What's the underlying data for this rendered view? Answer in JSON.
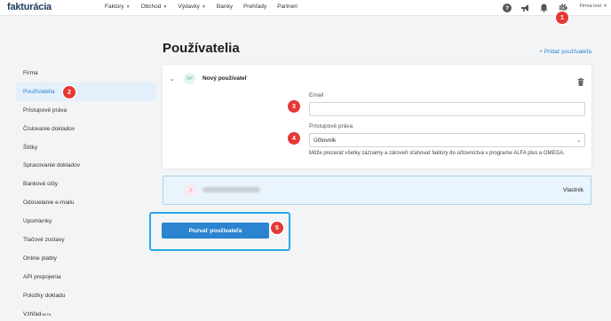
{
  "app": {
    "logo": "fakturácia"
  },
  "nav": {
    "items": [
      {
        "label": "Faktúry",
        "has_dropdown": true
      },
      {
        "label": "Obchod",
        "has_dropdown": true
      },
      {
        "label": "Výdavky",
        "has_dropdown": true
      },
      {
        "label": "Banky",
        "has_dropdown": false
      },
      {
        "label": "Prehľady",
        "has_dropdown": false
      },
      {
        "label": "Partneri",
        "has_dropdown": false
      }
    ],
    "icons": [
      "help-icon",
      "megaphone-icon",
      "bell-icon",
      "gear-icon"
    ],
    "company": "Firma test"
  },
  "sidebar": {
    "items": [
      {
        "label": "Firma"
      },
      {
        "label": "Používatelia",
        "active": true
      },
      {
        "label": "Prístupové práva"
      },
      {
        "label": "Číslovanie dokladov"
      },
      {
        "label": "Štítky"
      },
      {
        "label": "Spracovanie dokladov"
      },
      {
        "label": "Bankové účty"
      },
      {
        "label": "Odosielanie e-mailu"
      },
      {
        "label": "Upomienky"
      },
      {
        "label": "Tlačové zostavy"
      },
      {
        "label": "Online platby"
      },
      {
        "label": "API prepojenia"
      },
      {
        "label": "Položky dokladu"
      },
      {
        "label": "Vzhľad",
        "sup": "BETA"
      }
    ]
  },
  "main": {
    "title": "Používatelia",
    "add_user": "Pridať používateľa",
    "new_user": {
      "initials": "NP",
      "title": "Nový používateľ",
      "email_label": "Email",
      "email_value": "",
      "rights_label": "Prístupové práva",
      "rights_value": "Účtovník",
      "rights_description": "Môže prezerať všetky záznamy a zároveň sťahovať faktúry do účtovníctva v programe ALFA plus a OMEGA."
    },
    "owner": {
      "initials": "J",
      "role": "Vlastník"
    },
    "invite_button": "Pozvať používateľa"
  },
  "markers": [
    "1",
    "2",
    "3",
    "4",
    "5"
  ],
  "colors": {
    "accent": "#2a84d0",
    "marker": "#e53935",
    "active_bg": "#e3f0fb",
    "frame": "#2aa8e8"
  }
}
